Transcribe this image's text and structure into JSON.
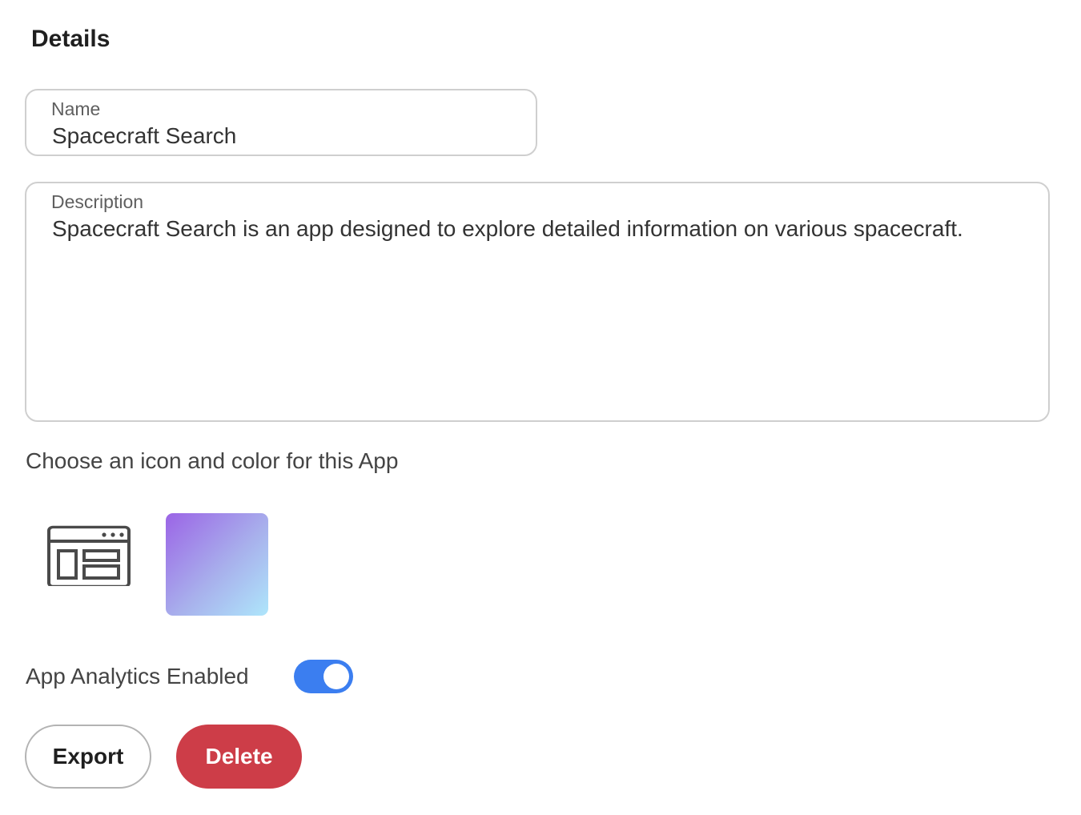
{
  "details": {
    "title": "Details"
  },
  "name_field": {
    "label": "Name",
    "value": "Spacecraft Search"
  },
  "description_field": {
    "label": "Description",
    "value": "Spacecraft Search is an app designed to explore detailed information on various spacecraft."
  },
  "appearance": {
    "prompt": "Choose an icon and color for this App",
    "icon": "app-layout-icon",
    "color_gradient": [
      "#9b64e6",
      "#aee6fb"
    ]
  },
  "analytics": {
    "label": "App Analytics Enabled",
    "enabled": true,
    "toggle_color": "#3b7ef0"
  },
  "actions": {
    "export_label": "Export",
    "delete_label": "Delete",
    "delete_color": "#cd3d48"
  }
}
